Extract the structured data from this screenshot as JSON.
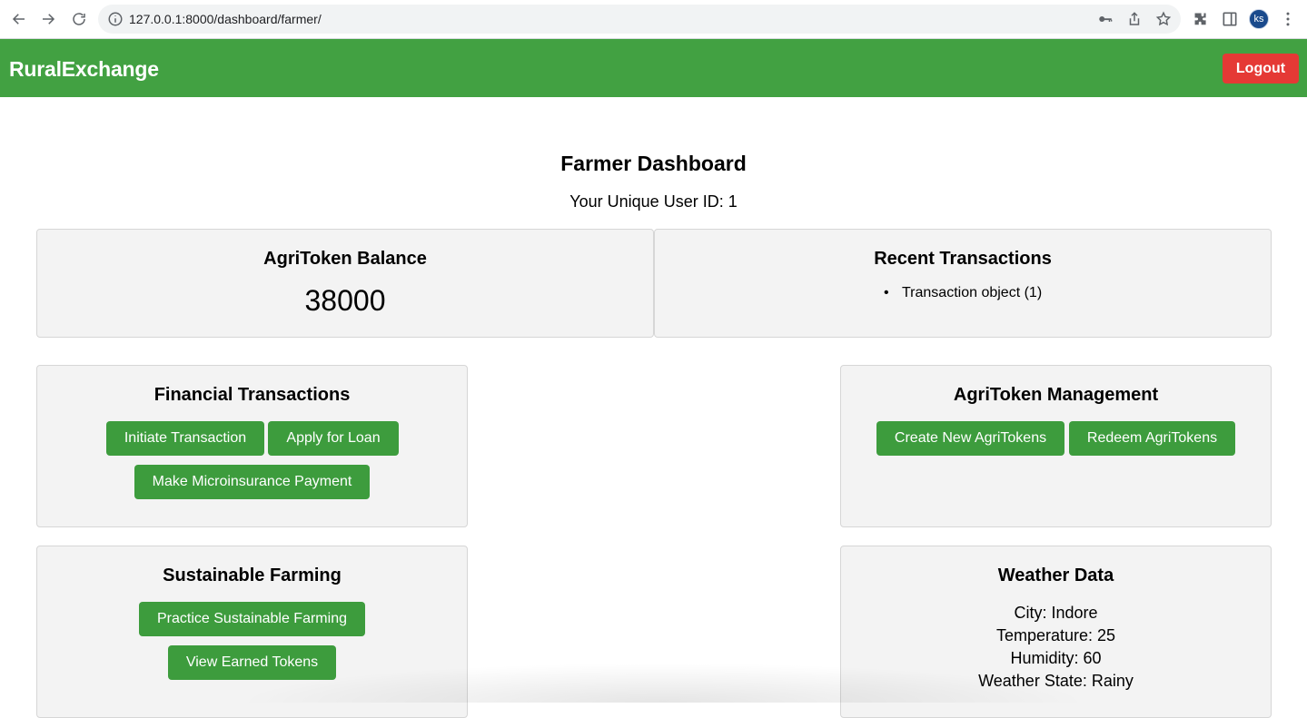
{
  "browser": {
    "url": "127.0.0.1:8000/dashboard/farmer/",
    "profile_initials": "ks"
  },
  "header": {
    "brand": "RuralExchange",
    "logout_label": "Logout",
    "bar_color": "#42a142",
    "logout_color": "#e53935"
  },
  "page": {
    "title": "Farmer Dashboard",
    "user_id_text": "Your Unique User ID: 1"
  },
  "balance_card": {
    "title": "AgriToken Balance",
    "value": "38000"
  },
  "transactions_card": {
    "title": "Recent Transactions",
    "items": [
      "Transaction object (1)"
    ]
  },
  "financial_card": {
    "title": "Financial Transactions",
    "buttons": [
      "Initiate Transaction",
      "Apply for Loan",
      "Make Microinsurance Payment"
    ]
  },
  "agritoken_card": {
    "title": "AgriToken Management",
    "buttons": [
      "Create New AgriTokens",
      "Redeem AgriTokens"
    ]
  },
  "sustainable_card": {
    "title": "Sustainable Farming",
    "buttons": [
      "Practice Sustainable Farming",
      "View Earned Tokens"
    ]
  },
  "weather_card": {
    "title": "Weather Data",
    "lines": [
      "City: Indore",
      "Temperature: 25",
      "Humidity: 60",
      "Weather State: Rainy"
    ]
  },
  "button_color": "#3d9c3d"
}
